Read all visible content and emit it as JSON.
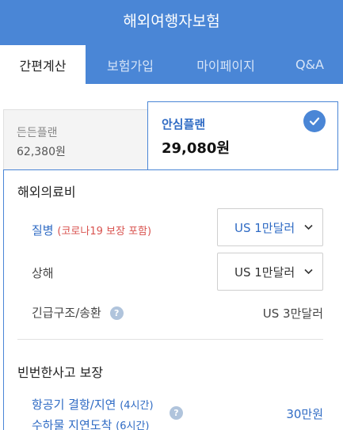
{
  "header": {
    "title": "해외여행자보험"
  },
  "tabs": [
    {
      "label": "간편계산",
      "active": true
    },
    {
      "label": "보험가입",
      "active": false
    },
    {
      "label": "마이페이지",
      "active": false
    },
    {
      "label": "Q&A",
      "active": false
    }
  ],
  "plans": {
    "basic": {
      "name": "든든플랜",
      "price": "62,380원"
    },
    "selected": {
      "name": "안심플랜",
      "price": "29,080원"
    }
  },
  "medical": {
    "title": "해외의료비",
    "illness": {
      "label": "질병",
      "note": "(코로나19 보장 포함)",
      "value": "US 1만달러"
    },
    "injury": {
      "label": "상해",
      "value": "US 1만달러"
    },
    "rescue": {
      "label": "긴급구조/송환",
      "value": "US 3만달러"
    }
  },
  "frequent": {
    "title": "빈번한사고 보장",
    "delay": {
      "line1": "항공기 결항/지연",
      "line1_note": "(4시간)",
      "line2": "수하물 지연도착",
      "line2_note": "(6시간)",
      "value": "30만원"
    }
  },
  "colors": {
    "brand": "#4a86d6",
    "accent_text": "#2f6bc4",
    "note_red": "#d9534f"
  }
}
